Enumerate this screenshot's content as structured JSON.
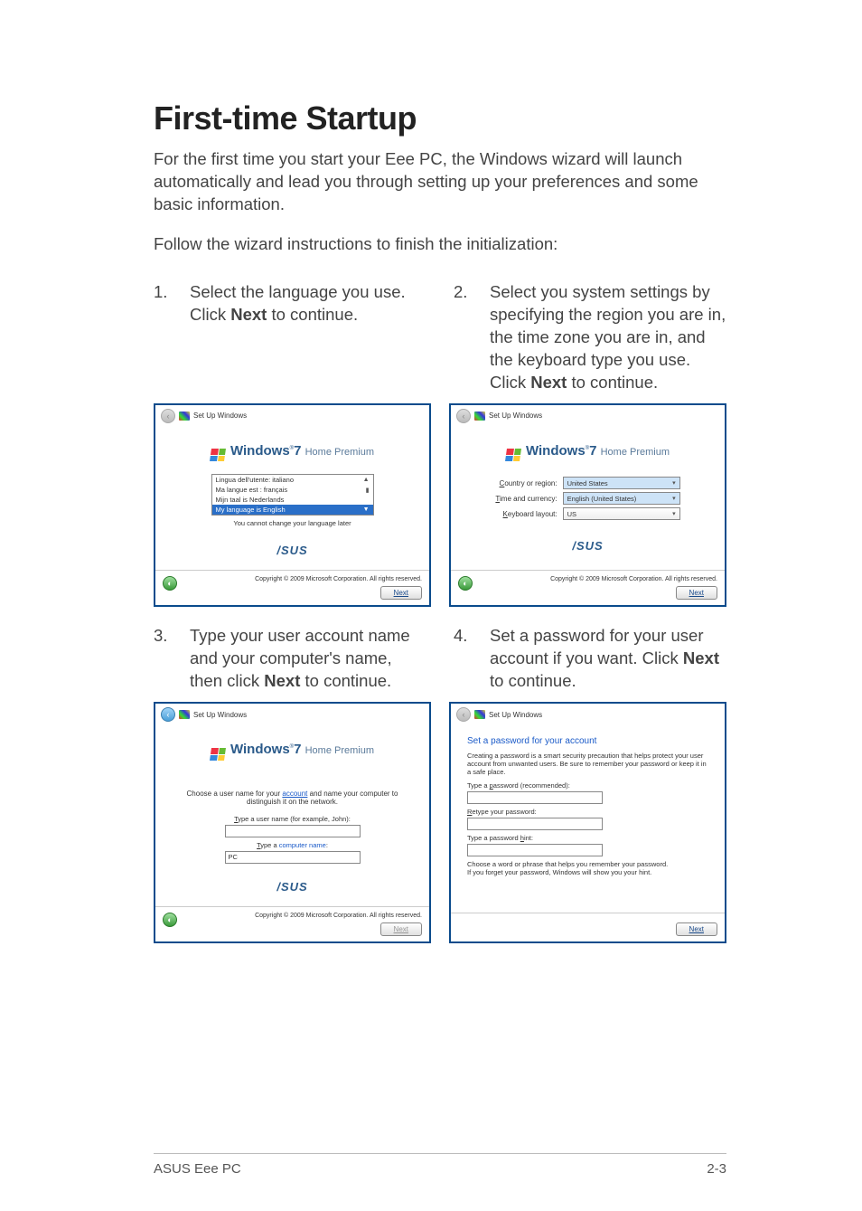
{
  "title": "First-time Startup",
  "intro": "For the first time you start your Eee PC, the Windows wizard will launch automatically and lead you through setting up your preferences and some basic information.",
  "follow": "Follow the wizard instructions to finish the initialization:",
  "steps": {
    "s1": {
      "num": "1.",
      "pre": "Select the language you use. Click ",
      "bold": "Next",
      "post": " to continue."
    },
    "s2": {
      "num": "2.",
      "pre": "Select you system settings by specifying the region you are in, the time zone you are in, and the keyboard type you use. Click ",
      "bold": "Next",
      "post": " to continue."
    },
    "s3": {
      "num": "3.",
      "pre": "Type your user account name and your computer's name, then click ",
      "bold": "Next",
      "post": " to continue."
    },
    "s4": {
      "num": "4.",
      "pre": "Set a password for your user account if you want. Click ",
      "bold": "Next",
      "post": " to continue."
    }
  },
  "win": {
    "setup": "Set Up Windows",
    "brand_pre": "Windows",
    "brand_ver": "7",
    "brand_ed": "Home Premium",
    "copyright": "Copyright © 2009 Microsoft Corporation. All rights reserved.",
    "next": "Next",
    "asus": "/SUS"
  },
  "shot1": {
    "langs": [
      "Lingua dell'utente: italiano",
      "Ma langue est : français",
      "Mijn taal is Nederlands",
      "My language is English"
    ],
    "note": "You cannot change your language later"
  },
  "shot2": {
    "country_l": "Country or region:",
    "country_v": "United States",
    "time_l": "Time and currency:",
    "time_v": "English (United States)",
    "kb_l": "Keyboard layout:",
    "kb_v": "US"
  },
  "shot3": {
    "top_pre": "Choose a user name for your ",
    "top_link": "account",
    "top_post": " and name your computer to distinguish it on the network.",
    "user_l": "Type a user name (for example, John):",
    "comp_pre": "Type a ",
    "comp_link": "computer name",
    "comp_post": ":",
    "comp_v": "PC"
  },
  "shot4": {
    "header": "Set a password for your account",
    "desc": "Creating a password is a smart security precaution that helps protect your user account from unwanted users. Be sure to remember your password or keep it in a safe place.",
    "pw_l": "Type a password (recommended):",
    "re_l": "Retype your password:",
    "hint_l": "Type a password hint:",
    "hint_desc": "Choose a word or phrase that helps you remember your password.\nIf you forget your password, Windows will show you your hint."
  },
  "footer": {
    "left": "ASUS Eee PC",
    "right": "2-3"
  }
}
